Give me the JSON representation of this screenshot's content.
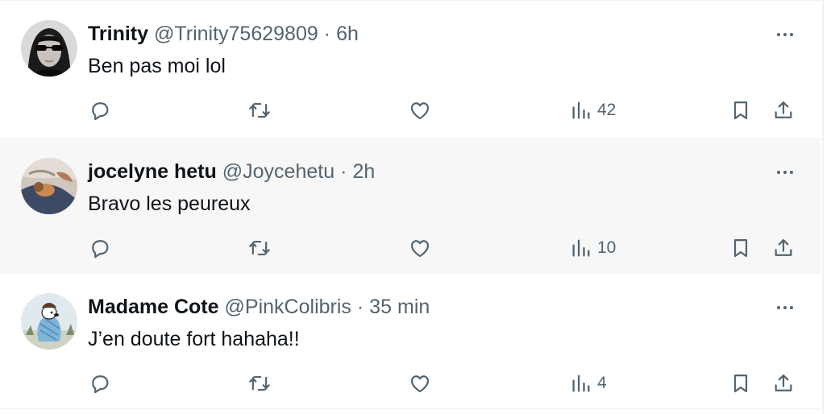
{
  "tweets": [
    {
      "name": "Trinity",
      "handle": "@Trinity75629809",
      "separator": "·",
      "time": "6h",
      "text": "Ben pas moi lol",
      "views": "42",
      "avatar": "trinity-avatar"
    },
    {
      "name": "jocelyne hetu",
      "handle": "@Joycehetu",
      "separator": "·",
      "time": "2h",
      "text": "Bravo les peureux",
      "views": "10",
      "avatar": "dog-avatar"
    },
    {
      "name": "Madame Cote",
      "handle": "@PinkColibris",
      "separator": "·",
      "time": "35 min",
      "text": "J’en doute fort hahaha!!",
      "views": "4",
      "avatar": "snoopy-avatar"
    }
  ],
  "colors": {
    "text_primary": "#0f1419",
    "text_secondary": "#536471",
    "hover_background": "#f7f7f7",
    "divider": "#eff3f4"
  },
  "icons": [
    "reply-icon",
    "retweet-icon",
    "like-icon",
    "views-icon",
    "bookmark-icon",
    "share-icon",
    "more-icon"
  ]
}
